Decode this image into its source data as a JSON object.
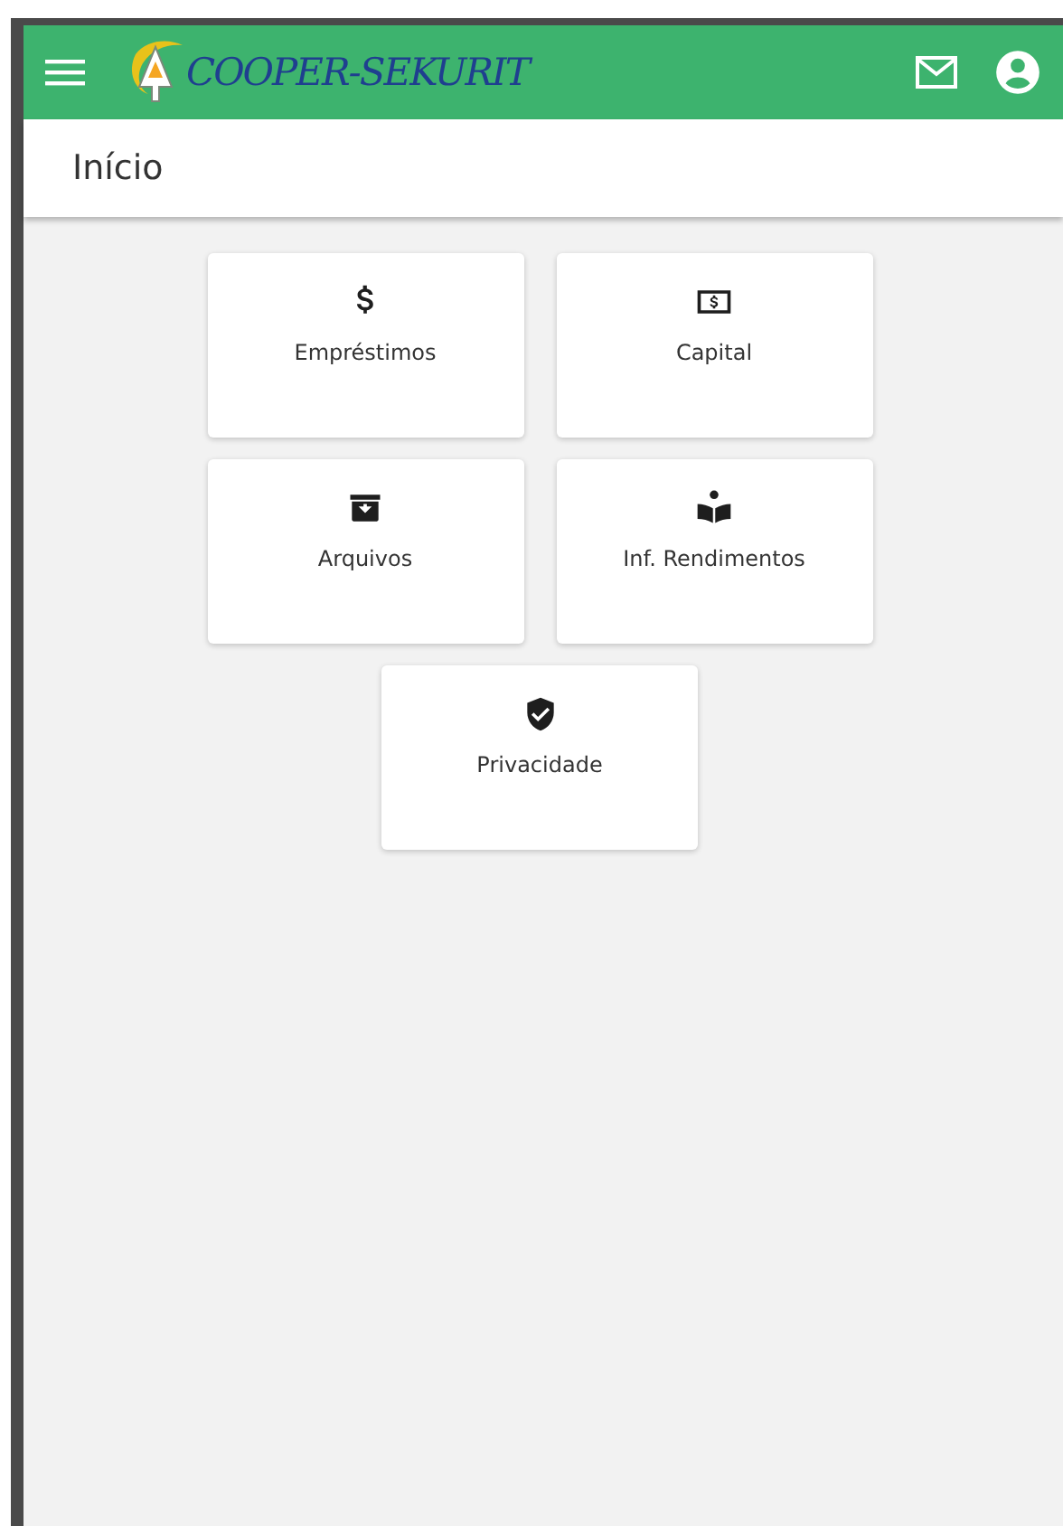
{
  "header": {
    "logo_text": "COOPER-SEKURIT"
  },
  "page_title": "Início",
  "tiles": [
    {
      "label": "Empréstimos"
    },
    {
      "label": "Capital"
    },
    {
      "label": "Arquivos"
    },
    {
      "label": "Inf. Rendimentos"
    },
    {
      "label": "Privacidade"
    }
  ]
}
